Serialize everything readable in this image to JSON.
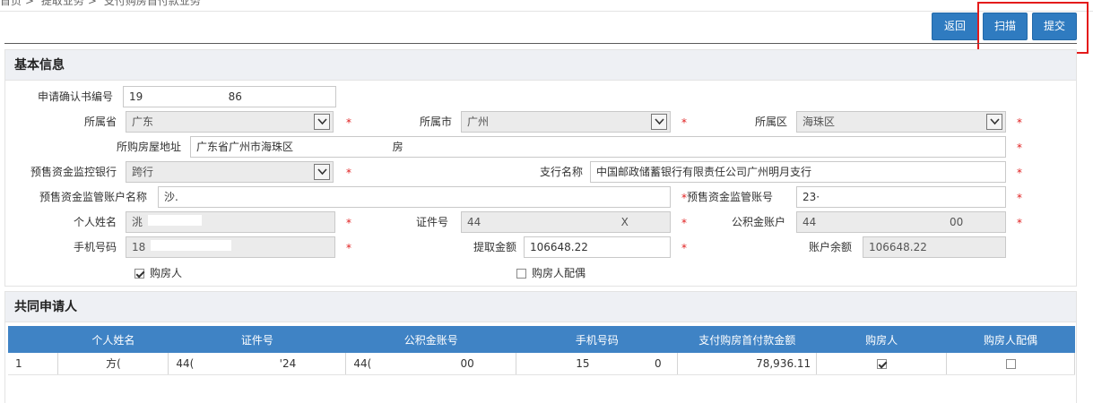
{
  "breadcrumb": [
    "首页",
    "提取业务",
    "支付购房首付款业务"
  ],
  "buttons": {
    "back": "返回",
    "scan": "扫描",
    "submit": "提交"
  },
  "basic": {
    "title": "基本信息",
    "confirm_no_label": "申请确认书编号",
    "confirm_no": "19                         86",
    "province_label": "所属省",
    "province": "广东",
    "city_label": "所属市",
    "city": "广州",
    "district_label": "所属区",
    "district": "海珠区",
    "address_label": "所购房屋地址",
    "address": "广东省广州市海珠区                             房",
    "bank_label": "预售资金监控银行",
    "bank": "跨行",
    "branch_label": "支行名称",
    "branch": "中国邮政储蓄银行有限责任公司广州明月支行",
    "account_name_label": "预售资金监管账户名称",
    "account_name": "沙.",
    "account_no_label": "预售资金监管账号",
    "account_no": "23·",
    "person_label": "个人姓名",
    "person": "洮",
    "idno_label": "证件号",
    "idno": "44                                         X",
    "fund_label": "公积金账户",
    "fund": "44                                       00",
    "phone_label": "手机号码",
    "phone": "18",
    "amount_label": "提取金额",
    "amount": "106648.22",
    "balance_label": "账户余额",
    "balance": "106648.22",
    "buyer_label": "购房人",
    "buyer_checked": true,
    "spouse_label": "购房人配偶",
    "spouse_checked": false,
    "required_mark": "*"
  },
  "co_applicants": {
    "title": "共同申请人",
    "columns": [
      "个人姓名",
      "证件号",
      "公积金账号",
      "手机号码",
      "支付购房首付款金额",
      "购房人",
      "购房人配偶"
    ],
    "rows": [
      {
        "index": "1",
        "name": "方(",
        "idno": "44(                         '24",
        "fund": "44(                          00",
        "phone": "15                   0",
        "amount": "78,936.11",
        "buyer": true,
        "spouse": false
      }
    ]
  }
}
